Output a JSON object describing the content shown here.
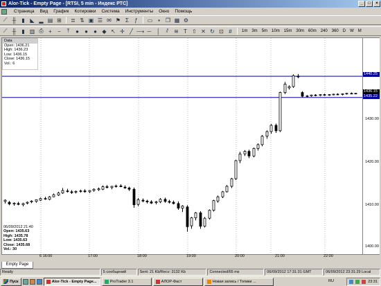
{
  "window": {
    "title": "Alor-Tick - Empty Page - [RTSI, 5 min - Индекс РТС]"
  },
  "menu": [
    "Страница",
    "Вид",
    "График",
    "Котировки",
    "Система",
    "Инструменты",
    "Окно",
    "Помощь"
  ],
  "timeframes": [
    "1m",
    "3m",
    "5m",
    "10m",
    "15m",
    "30m",
    "60m",
    "240",
    "360",
    "D",
    "W",
    "M"
  ],
  "data_window": {
    "title": "Data",
    "open": "Open: 1436.21",
    "high": "High: 1436.23",
    "low": "Low: 1436.15",
    "close": "Close: 1436.15",
    "vol": "Vol.: 6"
  },
  "bar_info": {
    "datetime": "06/09/2012 21:40",
    "open": "Open: 1435.63",
    "high": "High: 1435.78",
    "low": "Low: 1435.63",
    "close": "Close: 1435.68",
    "vol": "Vol.: 30"
  },
  "price_levels": {
    "upper": "1440.25",
    "current": "1436.15",
    "lower": "1435.22"
  },
  "level_color": "#0000a0",
  "chart_data": {
    "type": "candlestick",
    "y_ticks": [
      "1430.00",
      "1420.00",
      "1410.00",
      "1400.00"
    ],
    "x_ticks": [
      "6 16:00",
      "17:00",
      "18:00",
      "19:00",
      "20:00",
      "21:00",
      "22:00"
    ],
    "ylim": [
      1398.3,
      1449.0
    ],
    "candles": [
      [
        1410.5,
        1411.0,
        1410.0,
        1410.8
      ],
      [
        1410.3,
        1410.6,
        1409.6,
        1409.9
      ],
      [
        1409.9,
        1410.3,
        1409.5,
        1410.1
      ],
      [
        1410.0,
        1410.4,
        1409.6,
        1409.8
      ],
      [
        1409.7,
        1410.2,
        1409.3,
        1410.0
      ],
      [
        1410.1,
        1410.5,
        1409.8,
        1410.3
      ],
      [
        1410.4,
        1410.8,
        1410.1,
        1410.6
      ],
      [
        1410.5,
        1411.0,
        1410.2,
        1410.9
      ],
      [
        1410.8,
        1411.4,
        1410.6,
        1411.2
      ],
      [
        1411.2,
        1411.6,
        1410.9,
        1411.1
      ],
      [
        1411.0,
        1411.8,
        1410.8,
        1411.6
      ],
      [
        1411.6,
        1412.4,
        1411.5,
        1412.1
      ],
      [
        1412.0,
        1412.8,
        1411.8,
        1412.5
      ],
      [
        1412.5,
        1413.7,
        1412.3,
        1413.1
      ],
      [
        1413.0,
        1413.5,
        1412.6,
        1412.9
      ],
      [
        1412.8,
        1413.2,
        1412.3,
        1412.6
      ],
      [
        1412.7,
        1413.1,
        1412.4,
        1412.9
      ],
      [
        1412.9,
        1413.3,
        1412.6,
        1413.0
      ],
      [
        1413.0,
        1413.4,
        1412.6,
        1412.8
      ],
      [
        1412.8,
        1413.2,
        1412.5,
        1413.1
      ],
      [
        1413.1,
        1413.6,
        1412.8,
        1413.4
      ],
      [
        1413.3,
        1413.8,
        1413.0,
        1413.5
      ],
      [
        1413.4,
        1414.3,
        1413.2,
        1414.0
      ],
      [
        1414.0,
        1414.4,
        1413.6,
        1413.8
      ],
      [
        1413.8,
        1414.2,
        1413.4,
        1414.1
      ],
      [
        1414.1,
        1414.5,
        1413.8,
        1414.2
      ],
      [
        1414.2,
        1414.6,
        1413.9,
        1414.0
      ],
      [
        1413.9,
        1414.3,
        1413.5,
        1413.7
      ],
      [
        1413.7,
        1414.0,
        1413.0,
        1413.4
      ],
      [
        1413.4,
        1413.8,
        1409.0,
        1409.7
      ],
      [
        1409.8,
        1411.3,
        1409.4,
        1410.9
      ],
      [
        1410.8,
        1411.2,
        1410.3,
        1410.6
      ],
      [
        1410.6,
        1410.9,
        1410.0,
        1410.4
      ],
      [
        1410.4,
        1410.8,
        1409.9,
        1410.1
      ],
      [
        1410.2,
        1410.6,
        1409.8,
        1410.4
      ],
      [
        1410.4,
        1411.3,
        1410.1,
        1411.0
      ],
      [
        1411.0,
        1411.4,
        1410.2,
        1410.5
      ],
      [
        1410.5,
        1410.9,
        1410.0,
        1410.3
      ],
      [
        1410.3,
        1410.7,
        1409.8,
        1410.0
      ],
      [
        1410.0,
        1410.5,
        1408.5,
        1408.9
      ],
      [
        1408.9,
        1409.6,
        1408.0,
        1409.4
      ],
      [
        1409.2,
        1409.6,
        1403.3,
        1404.5
      ],
      [
        1404.7,
        1406.8,
        1404.0,
        1406.6
      ],
      [
        1406.6,
        1408.0,
        1406.0,
        1407.8
      ],
      [
        1407.8,
        1408.2,
        1404.0,
        1404.6
      ],
      [
        1404.6,
        1406.8,
        1404.3,
        1406.5
      ],
      [
        1406.5,
        1408.6,
        1406.2,
        1408.4
      ],
      [
        1408.4,
        1410.9,
        1408.1,
        1410.7
      ],
      [
        1410.6,
        1411.9,
        1410.2,
        1411.6
      ],
      [
        1411.6,
        1413.0,
        1411.3,
        1412.8
      ],
      [
        1412.8,
        1414.4,
        1412.6,
        1414.1
      ],
      [
        1414.1,
        1416.1,
        1413.7,
        1415.9
      ],
      [
        1415.9,
        1420.4,
        1415.6,
        1420.2
      ],
      [
        1420.2,
        1422.3,
        1419.6,
        1421.8
      ],
      [
        1421.8,
        1422.7,
        1421.3,
        1422.4
      ],
      [
        1422.4,
        1422.8,
        1420.8,
        1421.3
      ],
      [
        1421.3,
        1423.3,
        1421.0,
        1423.1
      ],
      [
        1423.1,
        1424.3,
        1422.6,
        1424.0
      ],
      [
        1424.0,
        1426.3,
        1423.6,
        1426.0
      ],
      [
        1426.0,
        1427.4,
        1425.4,
        1427.1
      ],
      [
        1427.1,
        1428.9,
        1426.6,
        1428.6
      ],
      [
        1428.6,
        1429.0,
        1426.8,
        1427.3
      ],
      [
        1427.3,
        1436.6,
        1427.0,
        1436.4
      ],
      [
        1436.4,
        1438.9,
        1436.0,
        1438.4
      ],
      [
        1437.5,
        1438.1,
        1437.1,
        1437.8
      ],
      [
        1437.8,
        1440.7,
        1437.5,
        1440.4
      ],
      [
        1440.3,
        1440.8,
        1439.8,
        1440.1
      ],
      [
        1436.4,
        1436.7,
        1435.2,
        1435.5
      ],
      [
        1435.5,
        1435.8,
        1435.2,
        1435.6
      ],
      [
        1435.6,
        1435.9,
        1435.4,
        1435.8
      ],
      [
        1435.8,
        1436.0,
        1435.5,
        1435.7
      ],
      [
        1435.7,
        1436.0,
        1435.5,
        1435.9
      ],
      [
        1435.9,
        1436.1,
        1435.6,
        1435.8
      ],
      [
        1435.8,
        1436.0,
        1435.6,
        1435.9
      ],
      [
        1435.9,
        1436.1,
        1435.7,
        1436.0
      ],
      [
        1436.0,
        1436.2,
        1435.8,
        1435.9
      ],
      [
        1435.9,
        1436.2,
        1435.7,
        1436.1
      ],
      [
        1436.1,
        1436.3,
        1435.9,
        1436.2
      ],
      [
        1436.2,
        1436.4,
        1436.0,
        1436.1
      ],
      [
        1436.21,
        1436.23,
        1436.15,
        1436.15
      ]
    ]
  },
  "tabs": [
    "Empty Page"
  ],
  "status": {
    "ready": "Ready",
    "messages": "5 сообщений",
    "traffic": "Sent: 21 Kb/Recv: 3132 Kb",
    "connection": "Connected/65 ms",
    "server_time": "06/09/2012 17:31:31 GMT",
    "local_time": "06/09/2012 23:31:29 Local"
  },
  "taskbar": {
    "start": "Пуск",
    "tasks": [
      "Alor-Tick - Empty Page...",
      "ProTrader 3.1",
      "АЛОР-Фаст",
      "Новая запись / Топики ..."
    ],
    "lang": "RU",
    "clock": "23:31"
  }
}
